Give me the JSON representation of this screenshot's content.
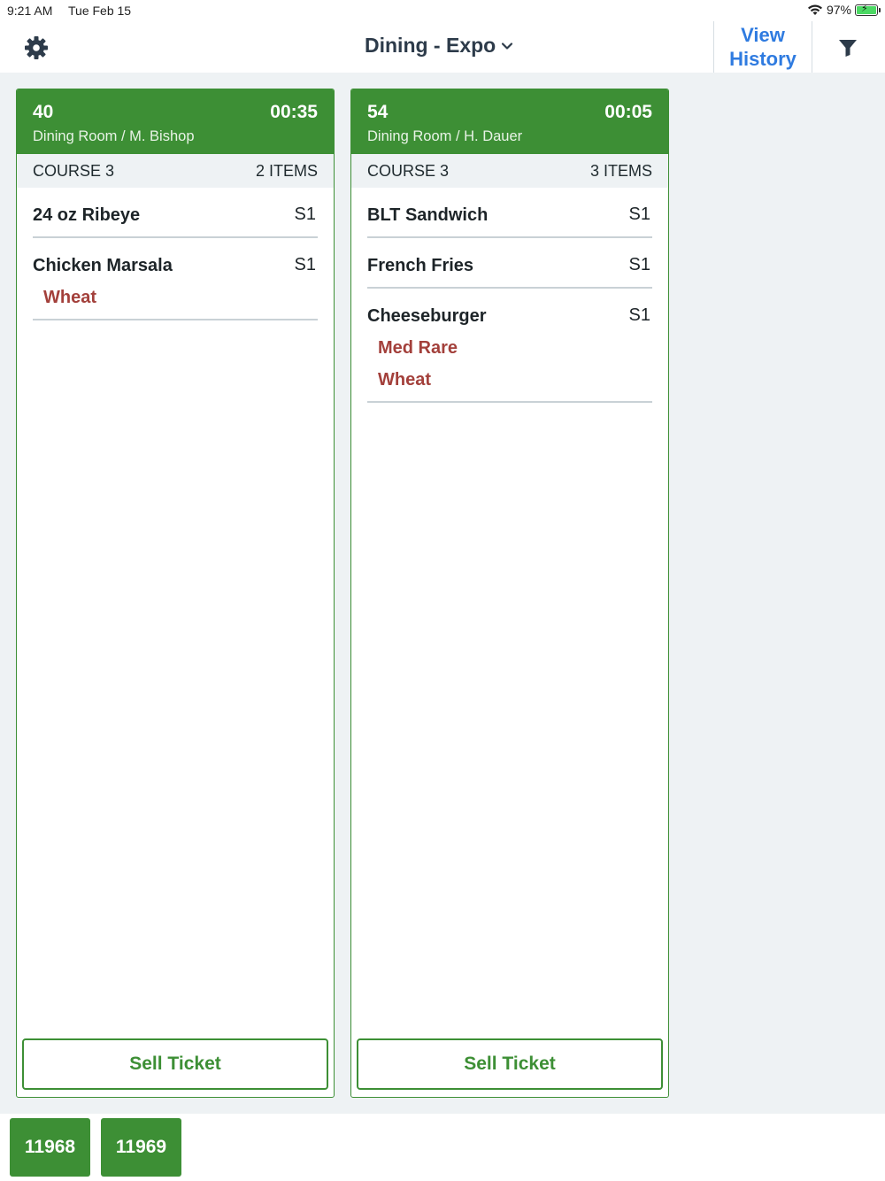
{
  "status_bar": {
    "time": "9:21 AM",
    "date": "Tue Feb 15",
    "battery_percent": "97%",
    "icons": [
      "wifi-icon",
      "battery-charging-icon"
    ]
  },
  "header": {
    "settings_icon": "gear-icon",
    "title": "Dining - Expo",
    "title_icon": "chevron-down-icon",
    "history_line1": "View",
    "history_line2": "History",
    "filter_icon": "funnel-icon"
  },
  "colors": {
    "accent_green": "#3d8f35",
    "modifier_red": "#a3403b",
    "link_blue": "#2f7be0"
  },
  "tickets": [
    {
      "number": "40",
      "timer": "00:35",
      "location": "Dining Room / M. Bishop",
      "course": "COURSE 3",
      "item_count": "2 ITEMS",
      "items": [
        {
          "name": "24 oz Ribeye",
          "seat": "S1",
          "modifiers": []
        },
        {
          "name": "Chicken Marsala",
          "seat": "S1",
          "modifiers": [
            "Wheat"
          ]
        }
      ],
      "action_label": "Sell Ticket"
    },
    {
      "number": "54",
      "timer": "00:05",
      "location": "Dining Room / H. Dauer",
      "course": "COURSE 3",
      "item_count": "3 ITEMS",
      "items": [
        {
          "name": "BLT Sandwich",
          "seat": "S1",
          "modifiers": []
        },
        {
          "name": "French Fries",
          "seat": "S1",
          "modifiers": []
        },
        {
          "name": "Cheeseburger",
          "seat": "S1",
          "modifiers": [
            "Med Rare",
            "Wheat"
          ]
        }
      ],
      "action_label": "Sell Ticket"
    }
  ],
  "bottom_tabs": [
    "11968",
    "11969"
  ]
}
